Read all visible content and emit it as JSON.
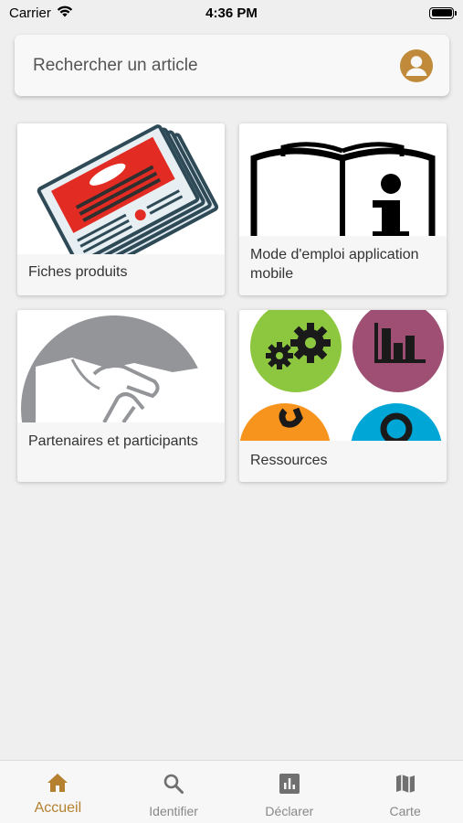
{
  "status_bar": {
    "carrier": "Carrier",
    "time": "4:36 PM"
  },
  "search": {
    "placeholder": "Rechercher un article"
  },
  "tiles": [
    {
      "label": "Fiches produits",
      "icon": "product-sheets-icon"
    },
    {
      "label": "Mode d'emploi application mobile",
      "icon": "manual-info-icon"
    },
    {
      "label": "Partenaires et participants",
      "icon": "handshake-icon"
    },
    {
      "label": "Ressources",
      "icon": "resources-icon"
    }
  ],
  "tab_bar": {
    "active": "Accueil",
    "items": [
      {
        "label": "Accueil",
        "icon": "home-icon"
      },
      {
        "label": "Identifier",
        "icon": "search-icon"
      },
      {
        "label": "Déclarer",
        "icon": "bar-chart-icon"
      },
      {
        "label": "Carte",
        "icon": "map-icon"
      }
    ]
  },
  "colors": {
    "accent": "#b58130",
    "background": "#efefef"
  }
}
